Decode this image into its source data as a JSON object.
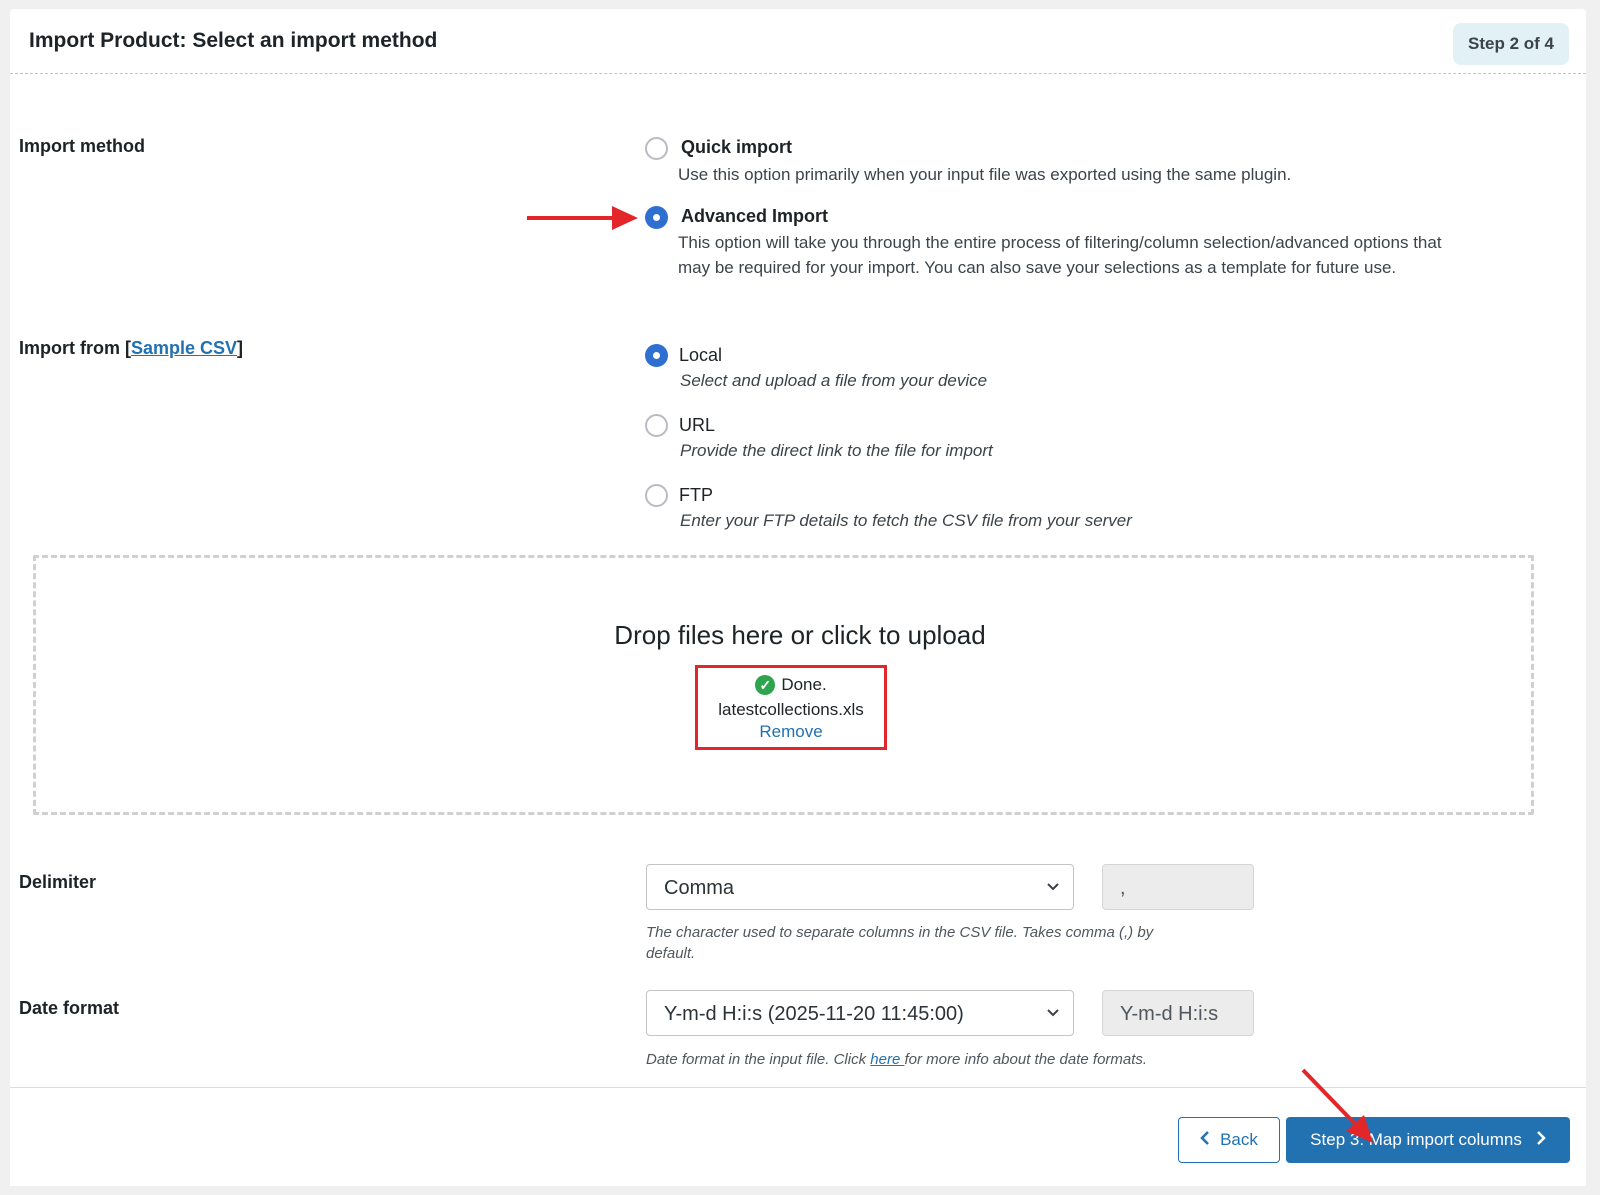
{
  "header": {
    "title": "Import Product: Select an import method",
    "step_badge": "Step 2 of 4"
  },
  "import_method": {
    "label": "Import method",
    "options": [
      {
        "title": "Quick import",
        "description": "Use this option primarily when your input file was exported using the same plugin.",
        "selected": false
      },
      {
        "title": "Advanced Import",
        "description_line1": "This option will take you through the entire process of filtering/column selection/advanced options that",
        "description_line2": "may be required for your import. You can also save your selections as a template for future use.",
        "selected": true
      }
    ]
  },
  "import_from": {
    "label_prefix": "Import from [",
    "sample_link": "Sample CSV",
    "label_suffix": "]",
    "options": [
      {
        "title": "Local",
        "description": "Select and upload a file from your device",
        "selected": true
      },
      {
        "title": "URL",
        "description": "Provide the direct link to the file for import",
        "selected": false
      },
      {
        "title": "FTP",
        "description": "Enter your FTP details to fetch the CSV file from your server",
        "selected": false
      }
    ]
  },
  "upload": {
    "drop_text": "Drop files here or click to upload",
    "status": "Done.",
    "file_name": "latestcollections.xls",
    "remove_label": "Remove"
  },
  "delimiter": {
    "label": "Delimiter",
    "selected": "Comma",
    "value": ",",
    "help": "The character used to separate columns in the CSV file. Takes comma (,) by",
    "help_line2": "default."
  },
  "date_format": {
    "label": "Date format",
    "selected": "Y-m-d H:i:s (2025-11-20 11:45:00)",
    "value": "Y-m-d H:i:s",
    "help_prefix": "Date format in the input file. Click ",
    "help_link": "here ",
    "help_suffix": "for more info about the date formats."
  },
  "footer": {
    "back_label": "Back",
    "next_label": "Step 3: Map import columns"
  },
  "colors": {
    "accent": "#2271b1",
    "radio_selected": "#2e6fd0",
    "annotation_red": "#e2262a",
    "success_green": "#2ea44f"
  }
}
